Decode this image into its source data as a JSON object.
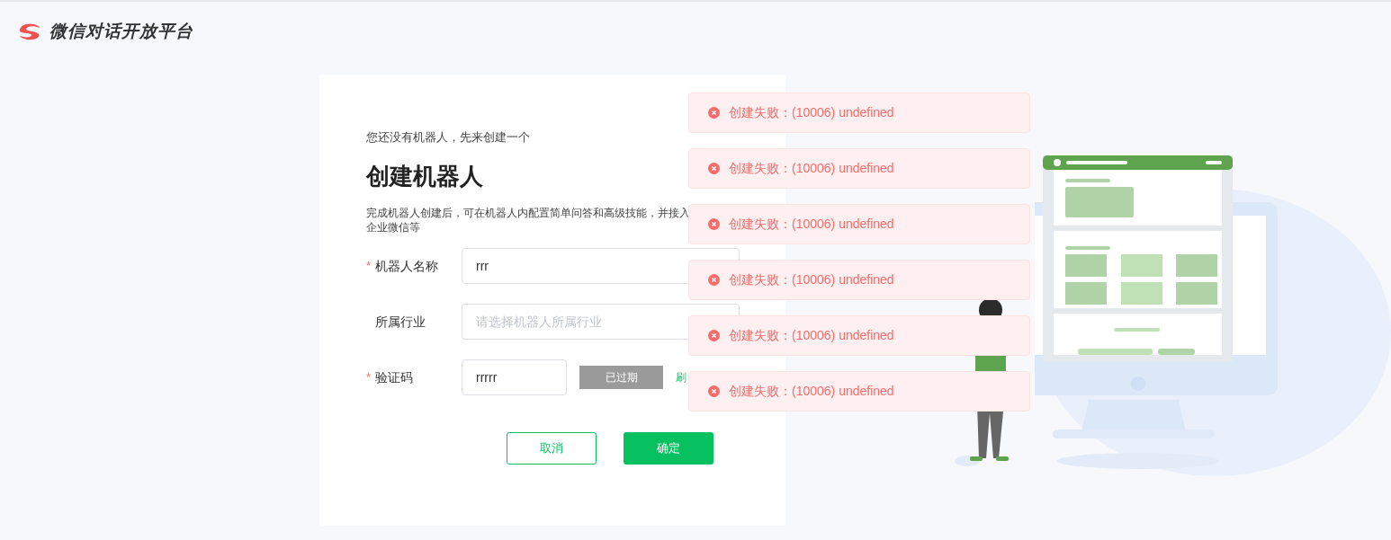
{
  "header": {
    "brand": "微信对话开放平台"
  },
  "card": {
    "intro": "您还没有机器人，先来创建一个",
    "title": "创建机器人",
    "description": "完成机器人创建后，可在机器人内配置简单问答和高级技能，并接入企业微信等",
    "fields": [
      {
        "kind": "text",
        "required_mark": "*",
        "label": "机器人名称",
        "value": "rrr"
      },
      {
        "kind": "select",
        "label": "所属行业",
        "placeholder": "请选择机器人所属行业"
      },
      {
        "kind": "captcha",
        "required_mark": "*",
        "label": "验证码",
        "value": "rrrrr",
        "captcha_text": "已过期",
        "refresh": "刷"
      }
    ],
    "buttons": [
      {
        "label": "取消",
        "kind": "secondary"
      },
      {
        "label": "确定",
        "kind": "primary"
      }
    ]
  },
  "toasts": [
    {
      "message": "创建失败：(10006) undefined"
    },
    {
      "message": "创建失败：(10006) undefined"
    },
    {
      "message": "创建失败：(10006) undefined"
    },
    {
      "message": "创建失败：(10006) undefined"
    },
    {
      "message": "创建失败：(10006) undefined"
    },
    {
      "message": "创建失败：(10006) undefined"
    }
  ]
}
